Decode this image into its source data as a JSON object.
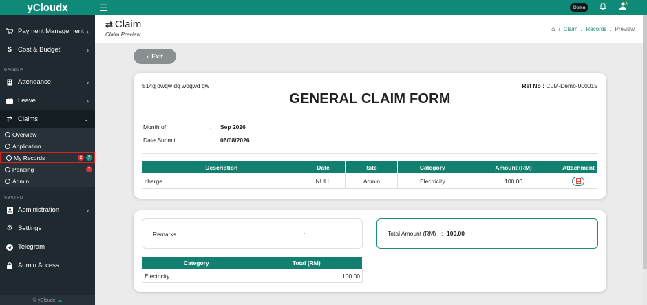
{
  "app": {
    "brand": "yCloudx"
  },
  "sidebar": {
    "top_items": [
      {
        "label": "Payment Management",
        "icon": "cart-icon"
      },
      {
        "label": "Cost & Budget",
        "icon": "dollar-icon"
      }
    ],
    "people_label": "PEOPLE",
    "people_items": [
      {
        "label": "Attendance",
        "icon": "building-icon"
      },
      {
        "label": "Leave",
        "icon": "briefcase-icon"
      },
      {
        "label": "Claims",
        "icon": "swap-icon"
      }
    ],
    "claims_sub": [
      {
        "label": "Overview"
      },
      {
        "label": "Application"
      },
      {
        "label": "My Records",
        "badge_red": "2",
        "badge_green": "7"
      },
      {
        "label": "Pending",
        "badge_red": "7"
      },
      {
        "label": "Admin"
      }
    ],
    "system_label": "SYSTEM",
    "system_items": [
      {
        "label": "Administration",
        "icon": "id-card-icon"
      },
      {
        "label": "Settings",
        "icon": "gear-icon"
      },
      {
        "label": "Telegram",
        "icon": "telegram-icon"
      },
      {
        "label": "Admin Access",
        "icon": "lock-icon"
      }
    ],
    "footer": "© yCloudx"
  },
  "topbar": {
    "demo_label": "Demo"
  },
  "header": {
    "title": "Claim",
    "subtitle": "Claim Preview",
    "breadcrumb": {
      "claim": "Claim",
      "records": "Records",
      "current": "Preview"
    }
  },
  "exit_label": "Exit",
  "form": {
    "company": "514q dwqw dq wdqwd qw",
    "ref_label": "Ref No :",
    "ref_value": "CLM-Demo-000015",
    "title": "GENERAL CLAIM FORM",
    "month_label": "Month of",
    "month_value": "Sep 2026",
    "date_label": "Date Submit",
    "date_value": "06/08/2026",
    "table_headers": [
      "Description",
      "Date",
      "Site",
      "Category",
      "Amount (RM)",
      "Attachment"
    ],
    "rows": [
      {
        "description": "charge",
        "date": "NULL",
        "site": "Admin",
        "category": "Electricity",
        "amount": "100.00"
      }
    ]
  },
  "summary": {
    "remarks_label": "Remarks",
    "remarks_colon": ":",
    "total_label": "Total Amount (RM)",
    "total_colon": ":",
    "total_value": "100.00",
    "table_headers": [
      "Category",
      "Total (RM)"
    ],
    "rows": [
      {
        "category": "Electricity",
        "total": "100.00"
      }
    ]
  },
  "colors": {
    "accent": "#0f8a78",
    "table_header": "#128070",
    "sidebar": "#1e2a2f",
    "badge_red": "#d9303a"
  }
}
